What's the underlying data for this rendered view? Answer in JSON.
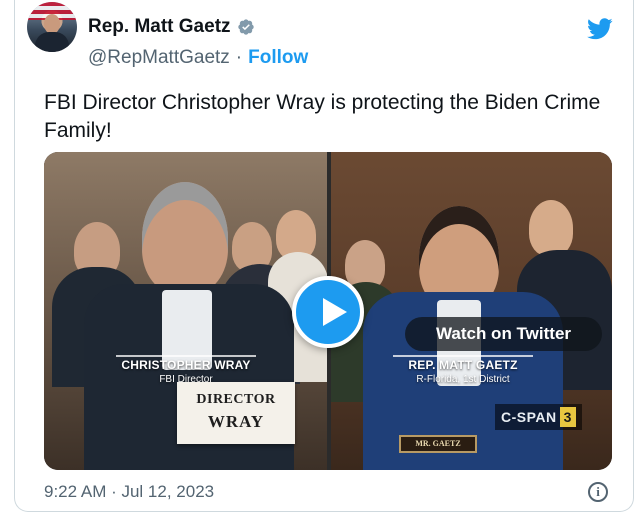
{
  "author": {
    "display_name": "Rep. Matt Gaetz",
    "handle": "@RepMattGaetz",
    "separator": "·",
    "follow_label": "Follow",
    "verified_color": "#829aab"
  },
  "brand": {
    "icon": "twitter-bird-icon",
    "color": "#1d9bf0"
  },
  "tweet": {
    "text": "FBI Director Christopher Wray is protecting the Biden Crime Family!"
  },
  "media": {
    "watch_label": "Watch on Twitter",
    "play_icon": "play-icon",
    "left_panel": {
      "caption_name": "CHRISTOPHER WRAY",
      "caption_title": "FBI Director",
      "nameplate_line1": "DIRECTOR",
      "nameplate_line2": "WRAY"
    },
    "right_panel": {
      "caption_name": "REP. MATT GAETZ",
      "caption_title": "R-Florida, 1st District",
      "desk_plate": "MR. GAETZ",
      "network_name": "C-SPAN",
      "network_number": "3"
    }
  },
  "footer": {
    "timestamp": "9:22 AM · Jul 12, 2023",
    "info_icon": "info-icon",
    "info_glyph": "i"
  }
}
